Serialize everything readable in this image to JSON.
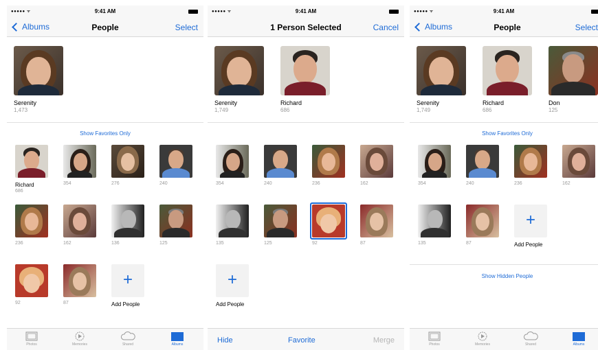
{
  "status": {
    "signal": "●●●●● ᯤ",
    "time": "9:41 AM"
  },
  "screen1": {
    "nav": {
      "back_label": "Albums",
      "title": "People",
      "right_label": "Select"
    },
    "favorites": [
      {
        "name": "Serenity",
        "count": "1,473"
      }
    ],
    "show_favorites_label": "Show Favorites Only",
    "grid": [
      {
        "name": "Richard",
        "count": "686"
      },
      {
        "count": "354"
      },
      {
        "count": "276"
      },
      {
        "count": "240"
      },
      {
        "count": "236"
      },
      {
        "count": "162"
      },
      {
        "count": "136"
      },
      {
        "count": "125"
      },
      {
        "count": "92"
      },
      {
        "count": "87"
      }
    ],
    "add_people_label": "Add People",
    "tabs": [
      {
        "label": "Photos"
      },
      {
        "label": "Memories"
      },
      {
        "label": "Shared"
      },
      {
        "label": "Albums"
      }
    ]
  },
  "screen2": {
    "nav": {
      "title": "1 Person Selected",
      "right_label": "Cancel"
    },
    "favorites": [
      {
        "name": "Serenity",
        "count": "1,749"
      },
      {
        "name": "Richard",
        "count": "686"
      }
    ],
    "grid": [
      {
        "count": "354"
      },
      {
        "count": "240"
      },
      {
        "count": "236"
      },
      {
        "count": "162"
      },
      {
        "count": "135"
      },
      {
        "count": "125"
      },
      {
        "count": "92"
      },
      {
        "count": "87"
      }
    ],
    "add_people_label": "Add People",
    "actions": {
      "hide": "Hide",
      "favorite": "Favorite",
      "merge": "Merge"
    }
  },
  "screen3": {
    "nav": {
      "back_label": "Albums",
      "title": "People",
      "right_label": "Select"
    },
    "favorites": [
      {
        "name": "Serenity",
        "count": "1,749"
      },
      {
        "name": "Richard",
        "count": "686"
      },
      {
        "name": "Don",
        "count": "125"
      }
    ],
    "show_favorites_label": "Show Favorites Only",
    "grid": [
      {
        "count": "354"
      },
      {
        "count": "240"
      },
      {
        "count": "236"
      },
      {
        "count": "162"
      },
      {
        "count": "135"
      },
      {
        "count": "87"
      }
    ],
    "add_people_label": "Add People",
    "show_hidden_label": "Show Hidden People",
    "tabs": [
      {
        "label": "Photos"
      },
      {
        "label": "Memories"
      },
      {
        "label": "Shared"
      },
      {
        "label": "Albums"
      }
    ]
  },
  "colors": {
    "accent": "#1e6bd6",
    "muted": "#9a9a9a",
    "bar": "#f7f7f7"
  },
  "icons": [
    "chevron-left-icon",
    "plus-icon",
    "photos-tab-icon",
    "memories-tab-icon",
    "shared-tab-icon",
    "albums-tab-icon"
  ]
}
